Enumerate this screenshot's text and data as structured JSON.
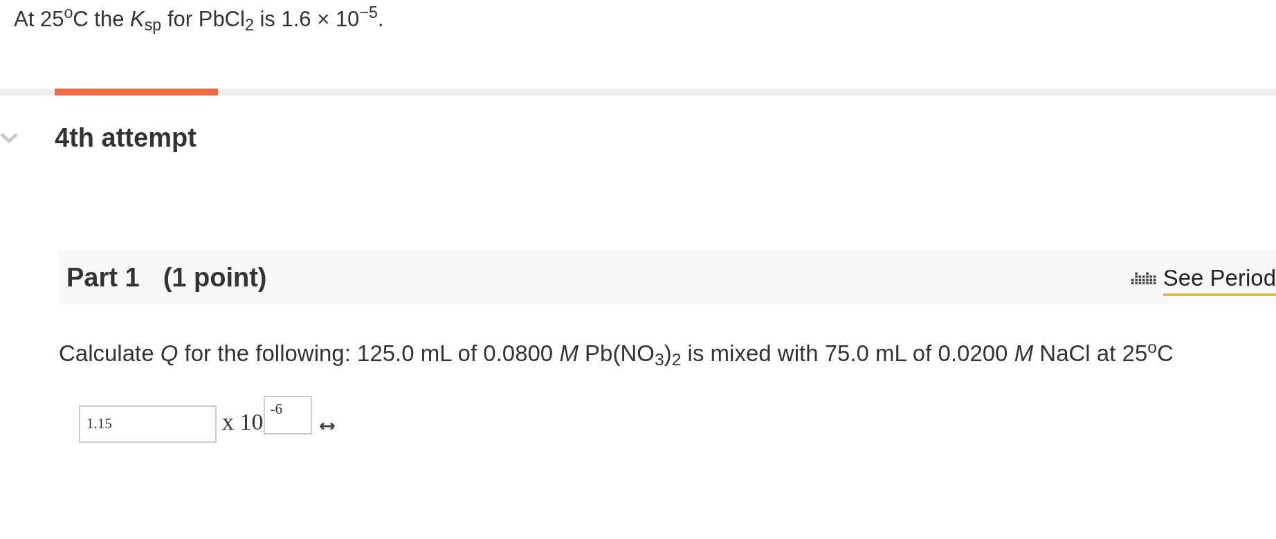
{
  "intro": "At 25$^{o}$C the *K*$_{sp}$ for PbCl$_{2}$ is 1.6 × 10$^{−5}$.",
  "attempt": {
    "title": "4th attempt",
    "expanded": true
  },
  "part": {
    "title": "Part 1",
    "points": "(1 point)",
    "link": "See Period"
  },
  "question": "Calculate *Q* for the following: 125.0 mL of 0.0800 *M* Pb(NO$_{3}$)$_{2}$ is mixed with 75.0 mL of 0.0200 *M* NaCl at 25$^{o}$C",
  "answer": {
    "mantissa": "1.15",
    "times": "x 10",
    "exponent": "-6"
  }
}
